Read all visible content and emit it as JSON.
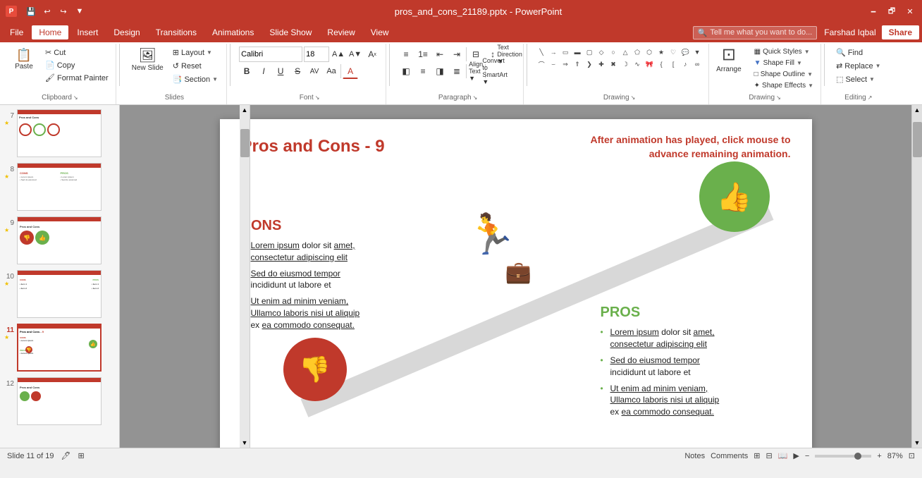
{
  "titlebar": {
    "filename": "pros_and_cons_21189.pptx - PowerPoint",
    "user": "Farshad Iqbal",
    "share_label": "Share"
  },
  "quickaccess": {
    "save": "💾",
    "undo": "↩",
    "redo": "↪",
    "customize": "▼"
  },
  "menubar": {
    "items": [
      "File",
      "Home",
      "Insert",
      "Design",
      "Transitions",
      "Animations",
      "Slide Show",
      "Review",
      "View"
    ],
    "active": "Home",
    "search_placeholder": "Tell me what you want to do..."
  },
  "ribbon": {
    "clipboard": {
      "label": "Clipboard",
      "paste_label": "Paste",
      "cut_label": "Cut",
      "copy_label": "Copy",
      "format_painter_label": "Format Painter"
    },
    "slides": {
      "label": "Slides",
      "new_slide_label": "New Slide",
      "layout_label": "Layout",
      "reset_label": "Reset",
      "section_label": "Section"
    },
    "font": {
      "label": "Font",
      "font_name": "Calibri",
      "font_size": "18",
      "bold": "B",
      "italic": "I",
      "underline": "U",
      "strikethrough": "S",
      "increase_font": "A▲",
      "decrease_font": "A▼",
      "clear_format": "A",
      "font_color": "A",
      "char_spacing": "AV"
    },
    "paragraph": {
      "label": "Paragraph",
      "text_direction_label": "Text Direction",
      "align_text_label": "Align Text",
      "convert_smartart_label": "Convert to SmartArt"
    },
    "drawing": {
      "label": "Drawing",
      "arrange_label": "Arrange",
      "quick_styles_label": "Quick Styles",
      "shape_fill_label": "Shape Fill",
      "shape_outline_label": "Shape Outline",
      "shape_effects_label": "Shape Effects"
    },
    "editing": {
      "label": "Editing",
      "find_label": "Find",
      "replace_label": "Replace",
      "select_label": "Select"
    }
  },
  "slide": {
    "title": "Pros and Cons - ",
    "title_number": "9",
    "instruction": "After animation has played, click mouse to advance remaining animation.",
    "cons": {
      "heading": "CONS",
      "items": [
        "Lorem ipsum dolor sit amet, consectetur adipiscing elit",
        "Sed do eiusmod tempor incididunt ut labore et",
        "Ut enim ad minim veniam, Ullamco laboris nisi ut aliquip ex ea commodo consequat."
      ]
    },
    "pros": {
      "heading": "PROS",
      "items": [
        "Lorem ipsum dolor sit amet, consectetur adipiscing elit",
        "Sed do eiusmod tempor incididunt ut labore et",
        "Ut enim ad minim veniam, Ullamco laboris nisi ut aliquip ex ea commodo consequat."
      ]
    }
  },
  "thumbnails": [
    {
      "num": "7",
      "star": true
    },
    {
      "num": "8",
      "star": true
    },
    {
      "num": "9",
      "star": true
    },
    {
      "num": "10",
      "star": true
    },
    {
      "num": "11",
      "star": true,
      "active": true
    },
    {
      "num": "12",
      "star": false
    }
  ],
  "statusbar": {
    "slide_info": "Slide 11 of 19",
    "notes_label": "Notes",
    "comments_label": "Comments",
    "zoom_percent": "87%"
  }
}
